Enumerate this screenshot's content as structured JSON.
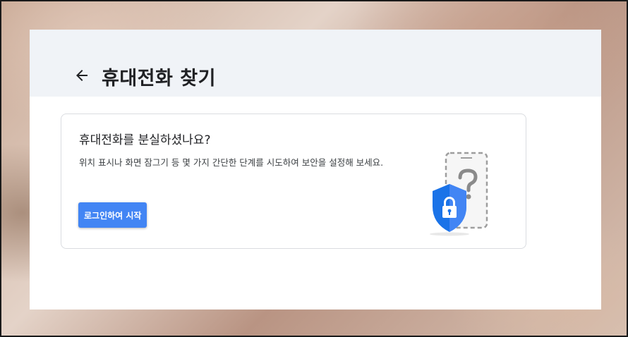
{
  "header": {
    "back_icon": "arrow-left-icon",
    "title": "휴대전화 찾기"
  },
  "card": {
    "title": "휴대전화를 분실하셨나요?",
    "description": "위치 표시나 화면 잠그기 등 몇 가지 간단한 단계를 시도하여 보안을 설정해 보세요.",
    "button_label": "로그인하여 시작",
    "illustration_icons": [
      "phone-question-icon",
      "security-shield-lock-icon"
    ]
  },
  "colors": {
    "accent": "#4285f4",
    "header_bg": "#f0f3f7",
    "title_text": "#202124"
  }
}
